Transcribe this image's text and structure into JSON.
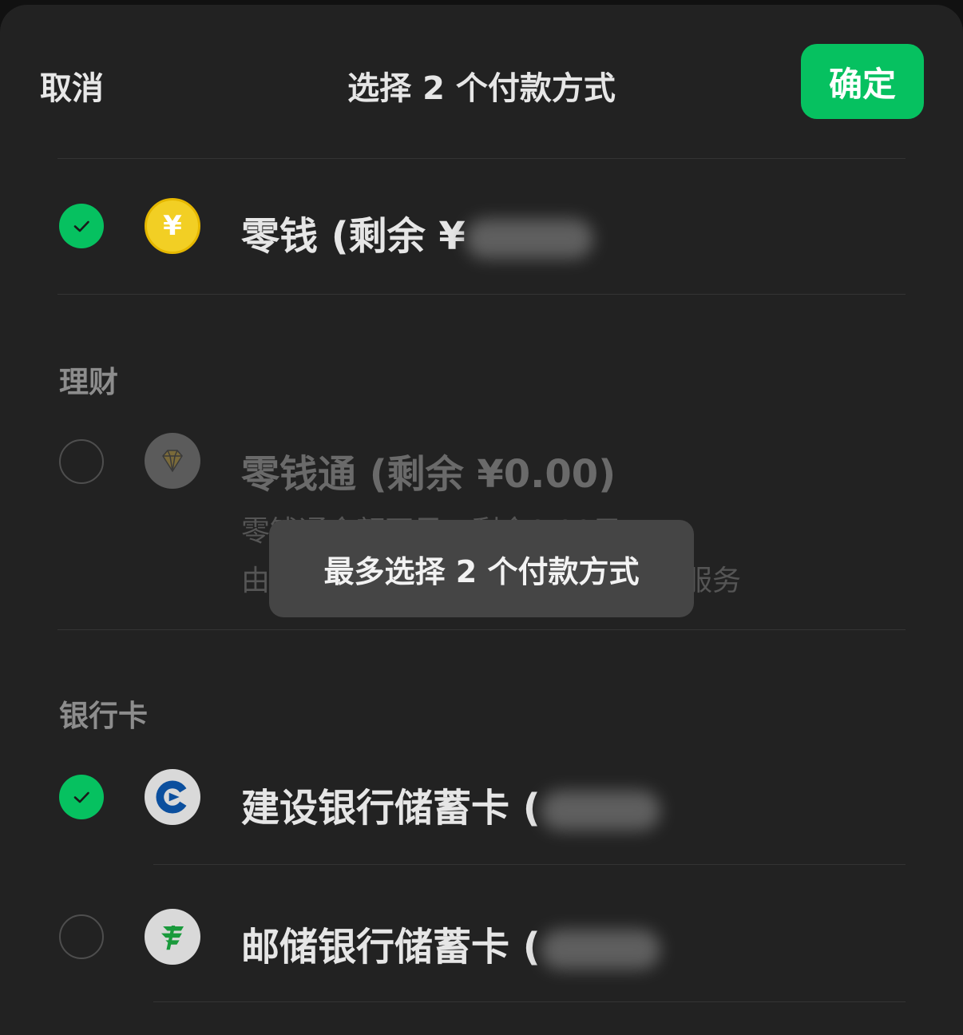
{
  "header": {
    "cancel_label": "取消",
    "title": "选择 2 个付款方式",
    "confirm_label": "确定"
  },
  "balance": {
    "label": "零钱 (剩余 ¥",
    "icon": "yuan-coin-icon",
    "icon_glyph": "¥",
    "checked": true
  },
  "wealth": {
    "section_title": "理财",
    "item": {
      "label": "零钱通 (剩余 ¥0.00)",
      "sub_line_1": "零钱通余额不足，剩余0.00元",
      "sub_line_2": "由",
      "sub_line_2_tail": "服务",
      "icon": "diamond-icon",
      "checked": false,
      "disabled": true
    }
  },
  "bank_cards": {
    "section_title": "银行卡",
    "items": [
      {
        "label": "建设银行储蓄卡 (",
        "icon": "ccb-bank-icon",
        "checked": true
      },
      {
        "label": "邮储银行储蓄卡 (",
        "icon": "psbc-bank-icon",
        "checked": false
      }
    ]
  },
  "toast": {
    "message": "最多选择 2 个付款方式"
  },
  "colors": {
    "accent": "#06c160",
    "background": "#222222",
    "toast": "#454545"
  }
}
